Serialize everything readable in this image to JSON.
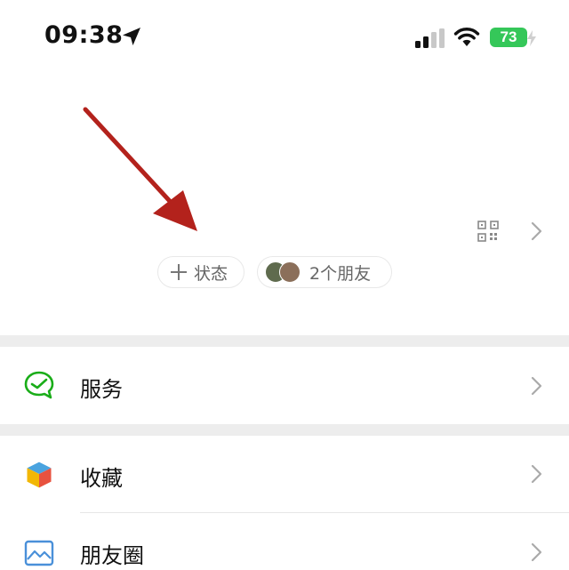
{
  "status_bar": {
    "time": "09:38",
    "battery_level": "73",
    "icons": [
      "location-arrow-icon",
      "cellular-signal-icon",
      "wifi-icon",
      "battery-icon"
    ]
  },
  "profile": {
    "status_button_label": "状态",
    "friends_label": "2个朋友",
    "icons": [
      "qr-code-icon",
      "chevron-right-icon"
    ]
  },
  "menu": {
    "items": [
      {
        "label": "服务",
        "icon": "services-icon"
      },
      {
        "label": "收藏",
        "icon": "favorites-icon"
      },
      {
        "label": "朋友圈",
        "icon": "moments-icon"
      }
    ]
  },
  "colors": {
    "battery": "#35c759",
    "services_icon": "#1aad19",
    "annotation_arrow": "#b3221c",
    "section_gap": "#ededed"
  }
}
